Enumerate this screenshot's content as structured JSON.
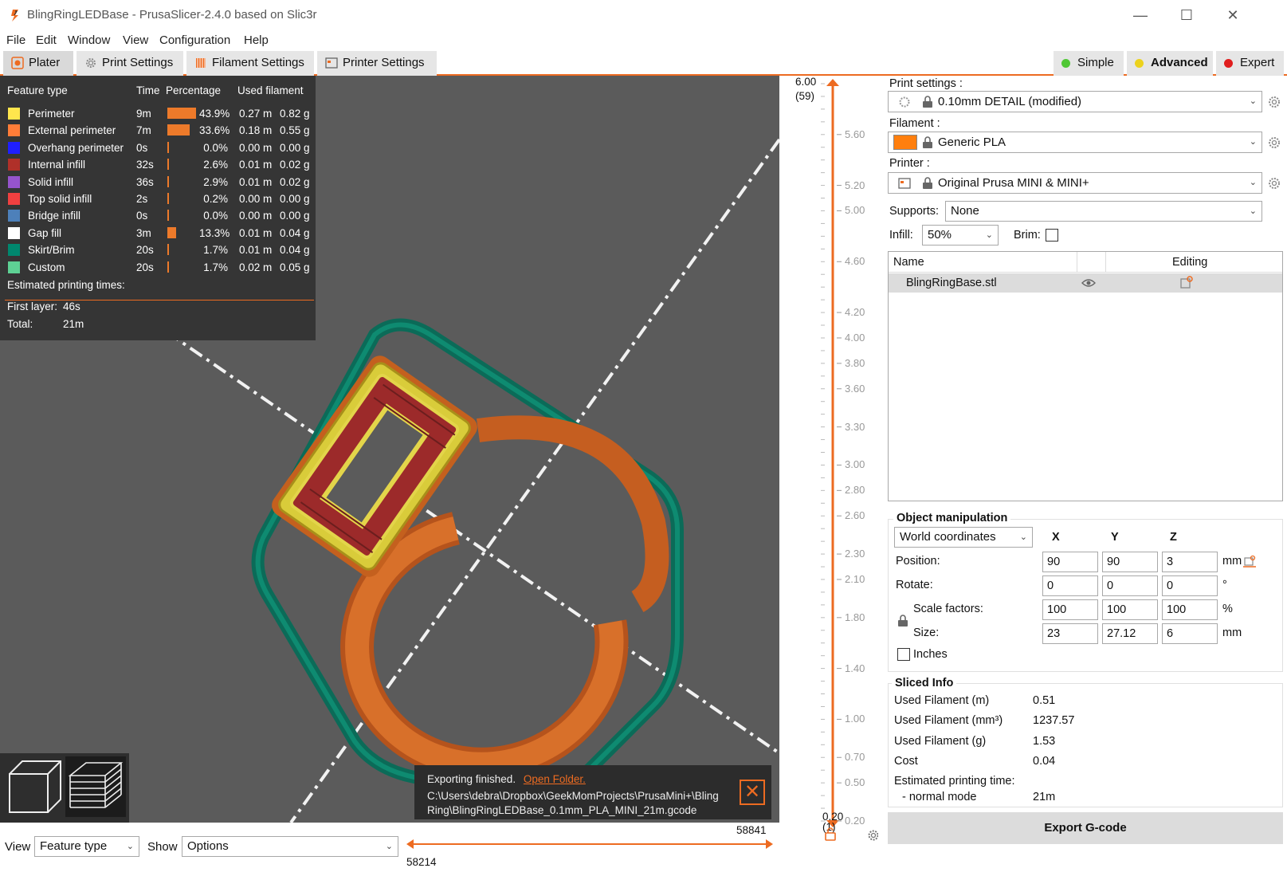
{
  "window": {
    "title": "BlingRingLEDBase - PrusaSlicer-2.4.0 based on Slic3r",
    "minimize": "—",
    "maximize": "☐",
    "close": "✕"
  },
  "menu": [
    "File",
    "Edit",
    "Window",
    "View",
    "Configuration",
    "Help"
  ],
  "tabs": {
    "plater": "Plater",
    "print": "Print Settings",
    "filament": "Filament Settings",
    "printer": "Printer Settings"
  },
  "modes": {
    "simple": "Simple",
    "advanced": "Advanced",
    "expert": "Expert",
    "colors": {
      "simple": "#4fc734",
      "advanced": "#ecd21d",
      "expert": "#e01e1e"
    }
  },
  "legend": {
    "headers": {
      "feature": "Feature type",
      "time": "Time",
      "percentage": "Percentage",
      "used": "Used filament"
    },
    "rows": [
      {
        "name": "Perimeter",
        "time": "9m",
        "pct": "43.9%",
        "pct_value": 43.9,
        "m": "0.27 m",
        "g": "0.82 g",
        "color": "#ffe64d"
      },
      {
        "name": "External perimeter",
        "time": "7m",
        "pct": "33.6%",
        "pct_value": 33.6,
        "m": "0.18 m",
        "g": "0.55 g",
        "color": "#ff7d38"
      },
      {
        "name": "Overhang perimeter",
        "time": "0s",
        "pct": "0.0%",
        "pct_value": 0,
        "m": "0.00 m",
        "g": "0.00 g",
        "color": "#1f1fff"
      },
      {
        "name": "Internal infill",
        "time": "32s",
        "pct": "2.6%",
        "pct_value": 2.6,
        "m": "0.01 m",
        "g": "0.02 g",
        "color": "#b03029"
      },
      {
        "name": "Solid infill",
        "time": "36s",
        "pct": "2.9%",
        "pct_value": 2.9,
        "m": "0.01 m",
        "g": "0.02 g",
        "color": "#9654cc"
      },
      {
        "name": "Top solid infill",
        "time": "2s",
        "pct": "0.2%",
        "pct_value": 0.2,
        "m": "0.00 m",
        "g": "0.00 g",
        "color": "#f04040"
      },
      {
        "name": "Bridge infill",
        "time": "0s",
        "pct": "0.0%",
        "pct_value": 0,
        "m": "0.00 m",
        "g": "0.00 g",
        "color": "#4d80ba"
      },
      {
        "name": "Gap fill",
        "time": "3m",
        "pct": "13.3%",
        "pct_value": 13.3,
        "m": "0.01 m",
        "g": "0.04 g",
        "color": "#ffffff"
      },
      {
        "name": "Skirt/Brim",
        "time": "20s",
        "pct": "1.7%",
        "pct_value": 1.7,
        "m": "0.01 m",
        "g": "0.04 g",
        "color": "#00876e"
      },
      {
        "name": "Custom",
        "time": "20s",
        "pct": "1.7%",
        "pct_value": 1.7,
        "m": "0.02 m",
        "g": "0.05 g",
        "color": "#5ed194"
      }
    ],
    "estimated_label": "Estimated printing times:",
    "first_layer_label": "First layer:",
    "first_layer_value": "46s",
    "total_label": "Total:",
    "total_value": "21m"
  },
  "toast": {
    "text": "Exporting finished.",
    "link": "Open Folder.",
    "path": "C:\\Users\\debra\\Dropbox\\GeekMomProjects\\PrusaMini+\\Bling Ring\\BlingRingLEDBase_0.1mm_PLA_MINI_21m.gcode",
    "close": "✕"
  },
  "bottom": {
    "view_label": "View",
    "view_value": "Feature type",
    "show_label": "Show",
    "show_value": "Options",
    "hslider_low": "58214",
    "hslider_high": "58841"
  },
  "vslider": {
    "top_value": "6.00",
    "top_layer": "(59)",
    "bottom_value": "0.20",
    "bottom_layer": "(1)",
    "ticks": [
      "5.60",
      "5.20",
      "5.00",
      "4.60",
      "4.20",
      "4.00",
      "3.80",
      "3.60",
      "3.30",
      "3.00",
      "2.80",
      "2.60",
      "2.30",
      "2.10",
      "1.80",
      "1.40",
      "1.00",
      "0.70",
      "0.50",
      "0.20"
    ]
  },
  "sidebar": {
    "print_settings_label": "Print settings :",
    "print_settings_value": "0.10mm DETAIL (modified)",
    "filament_label": "Filament :",
    "filament_value": "Generic PLA",
    "filament_color": "#ff7f0e",
    "printer_label": "Printer :",
    "printer_value": "Original Prusa MINI & MINI+",
    "supports_label": "Supports:",
    "supports_value": "None",
    "infill_label": "Infill:",
    "infill_value": "50%",
    "brim_label": "Brim:",
    "list_name_header": "Name",
    "list_editing_header": "Editing",
    "object_name": "BlingRingBase.stl",
    "manip_title": "Object manipulation",
    "coord_system": "World coordinates",
    "axis_x": "X",
    "axis_y": "Y",
    "axis_z": "Z",
    "position_label": "Position:",
    "position": [
      "90",
      "90",
      "3"
    ],
    "position_unit": "mm",
    "rotate_label": "Rotate:",
    "rotate": [
      "0",
      "0",
      "0"
    ],
    "rotate_unit": "°",
    "scale_label": "Scale factors:",
    "scale": [
      "100",
      "100",
      "100"
    ],
    "scale_unit": "%",
    "size_label": "Size:",
    "size": [
      "23",
      "27.12",
      "6"
    ],
    "size_unit": "mm",
    "inches_label": "Inches",
    "sliced_title": "Sliced Info",
    "used_m_label": "Used Filament (m)",
    "used_m": "0.51",
    "used_mm3_label": "Used Filament (mm³)",
    "used_mm3": "1237.57",
    "used_g_label": "Used Filament (g)",
    "used_g": "1.53",
    "cost_label": "Cost",
    "cost": "0.04",
    "est_time_label": "Estimated printing time:",
    "normal_mode_label": "- normal mode",
    "normal_mode": "21m",
    "export_button": "Export G-code"
  }
}
